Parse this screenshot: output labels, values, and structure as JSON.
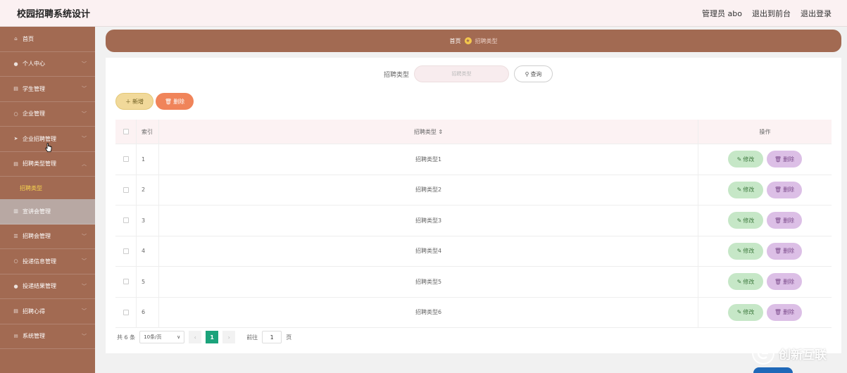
{
  "header": {
    "title": "校园招聘系统设计",
    "admin_label": "管理员 abo",
    "front_label": "退出到前台",
    "logout_label": "退出登录"
  },
  "sidebar": {
    "items": [
      {
        "label": "首页",
        "icon": "home-icon"
      },
      {
        "label": "个人中心",
        "icon": "user-icon"
      },
      {
        "label": "学生管理",
        "icon": "doc-icon"
      },
      {
        "label": "企业管理",
        "icon": "circle-icon"
      },
      {
        "label": "企业招聘管理",
        "icon": "send-icon"
      },
      {
        "label": "招聘类型管理",
        "icon": "doc-icon"
      },
      {
        "label": "宣讲会管理",
        "icon": "chart-icon"
      },
      {
        "label": "招聘会管理",
        "icon": "list-icon"
      },
      {
        "label": "投递信息管理",
        "icon": "circle-icon"
      },
      {
        "label": "投递结果管理",
        "icon": "user-icon"
      },
      {
        "label": "招聘心得",
        "icon": "doc-icon"
      },
      {
        "label": "系统管理",
        "icon": "mail-icon"
      }
    ],
    "sub_item": "招聘类型"
  },
  "breadcrumb": {
    "home": "首页",
    "current": "招聘类型"
  },
  "search": {
    "label": "招聘类型",
    "placeholder": "招聘类型",
    "button": "查询"
  },
  "actions": {
    "add": "新增",
    "delete": "删除"
  },
  "table": {
    "headers": {
      "index": "索引",
      "type": "招聘类型 ⇕",
      "ops": "操作"
    },
    "rows": [
      {
        "index": "1",
        "type": "招聘类型1"
      },
      {
        "index": "2",
        "type": "招聘类型2"
      },
      {
        "index": "3",
        "type": "招聘类型3"
      },
      {
        "index": "4",
        "type": "招聘类型4"
      },
      {
        "index": "5",
        "type": "招聘类型5"
      },
      {
        "index": "6",
        "type": "招聘类型6"
      }
    ],
    "edit_label": "修改",
    "delete_label": "删除"
  },
  "pagination": {
    "total": "共 6 条",
    "page_size": "10条/页",
    "current_page": "1",
    "goto_prefix": "前往",
    "goto_value": "1",
    "goto_suffix": "页"
  },
  "watermark": {
    "text": "创新互联"
  },
  "colors": {
    "sidebar": "#a26a52",
    "accent_yellow": "#f6d34f",
    "pager_active": "#1ba37b"
  }
}
